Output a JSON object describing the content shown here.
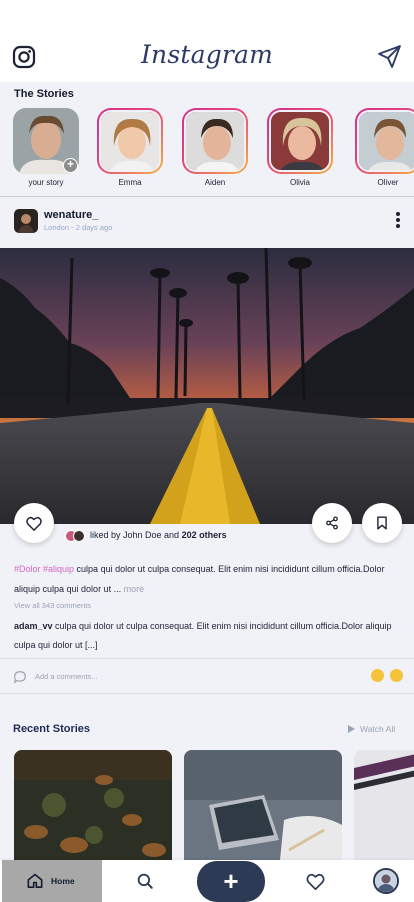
{
  "header": {
    "brand": "Instagram",
    "camera_icon": "instagram-glyph-icon",
    "send_icon": "paper-plane-icon"
  },
  "stories": {
    "title": "The Stories",
    "items": [
      {
        "name": "your story",
        "own": true
      },
      {
        "name": "Emma"
      },
      {
        "name": "Aiden"
      },
      {
        "name": "Olivia"
      },
      {
        "name": "Oliver"
      }
    ]
  },
  "post": {
    "username": "wenature_",
    "meta": "London - 2 days ago",
    "likes_prefix": "liked by John Doe and ",
    "likes_count": "202 others",
    "caption_tags": "#Dolor #aliquip",
    "caption_text": " culpa qui dolor ut culpa consequat. Elit enim nisi incididunt cillum officia.Dolor aliquip culpa qui dolor ut ... ",
    "caption_more": "more",
    "view_all": "View all 343 comments",
    "comment_user": "adam_vv",
    "comment_text": " culpa qui dolor ut culpa consequat. Elit enim nisi incididunt cillum officia.Dolor aliquip culpa qui dolor ut [...]",
    "add_comment_placeholder": "Add a comments..."
  },
  "recent": {
    "title": "Recent Stories",
    "watch_all": "Watch All"
  },
  "nav": {
    "home_label": "Home",
    "add_symbol": "+"
  },
  "colors": {
    "brand_navy": "#2c3a66",
    "story_ring_start": "#d2308e",
    "story_ring_end": "#f6b144",
    "hashtag": "#cf68c6",
    "muted": "#9aa3b4"
  }
}
